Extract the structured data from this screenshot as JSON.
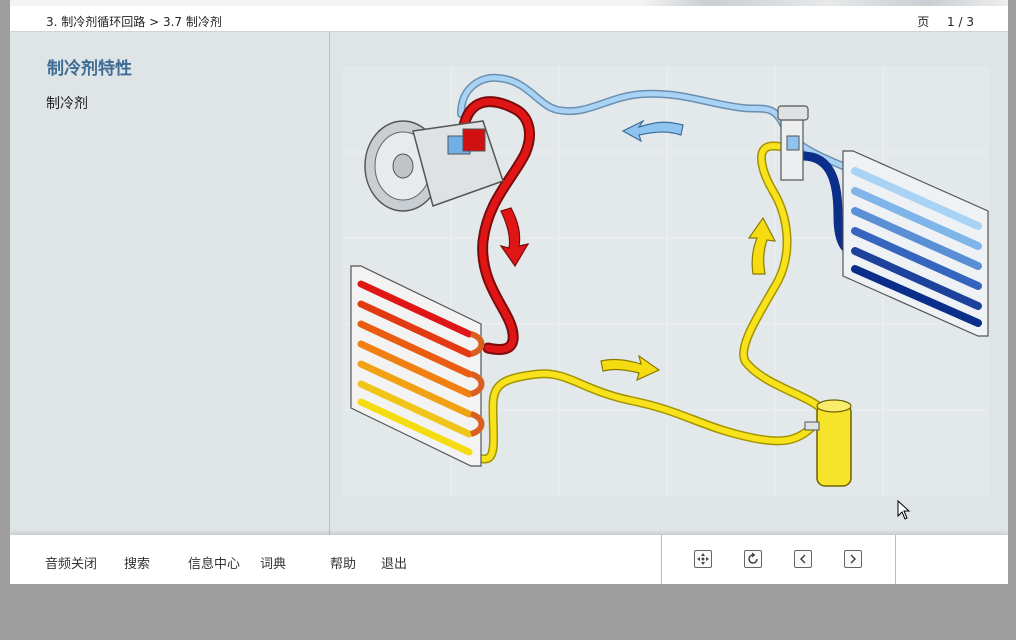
{
  "header": {
    "breadcrumb": "3. 制冷剂循环回路 > 3.7 制冷剂",
    "page_label": "页",
    "page_number": "1 / 3"
  },
  "content": {
    "title": "制冷剂特性",
    "subtitle": "制冷剂"
  },
  "footer": {
    "menu": [
      "音频关闭",
      "搜索",
      "信息中心",
      "词典",
      "帮助",
      "退出"
    ],
    "nav_icons": [
      "expand-icon",
      "refresh-icon",
      "chevron-left-icon",
      "chevron-right-icon"
    ]
  },
  "colors": {
    "title_blue": "#3e6c95",
    "hot_gas_red": "#d40e0e",
    "liquid_yellow": "#f5dc10",
    "low_pressure_light_blue": "#8ec4ef",
    "dark_blue": "#0a2e8a"
  }
}
